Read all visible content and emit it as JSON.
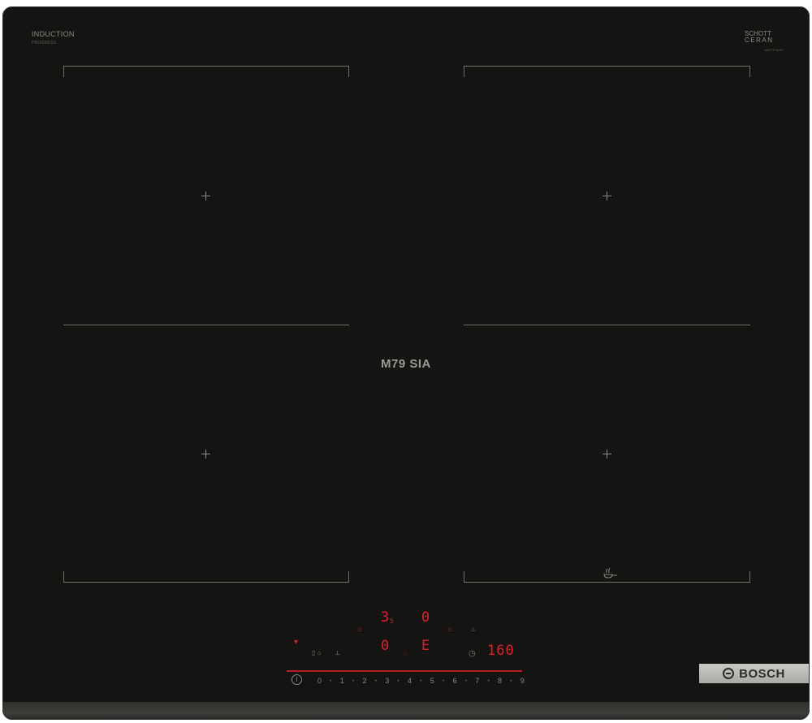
{
  "brand_left": {
    "title": "INDUCTION",
    "subtitle": "PROGRESS"
  },
  "brand_right": {
    "line1": "SCHOTT",
    "line2": "CERAN",
    "subtitle": "MATTFINISH"
  },
  "model_label": "M79 SIA",
  "display": {
    "top_left_digit": "3",
    "top_left_small": "5",
    "top_right_digit": "0",
    "bottom_left_digit": "0",
    "bottom_right_digit": "E",
    "timer_value": "160"
  },
  "slider": {
    "levels": [
      "0",
      "1",
      "2",
      "3",
      "4",
      "5",
      "6",
      "7",
      "8",
      "9"
    ]
  },
  "badge": {
    "text": "BOSCH"
  },
  "colors": {
    "glass": "#141512",
    "accent_red": "#e3202a",
    "badge": "#b9bab6"
  }
}
